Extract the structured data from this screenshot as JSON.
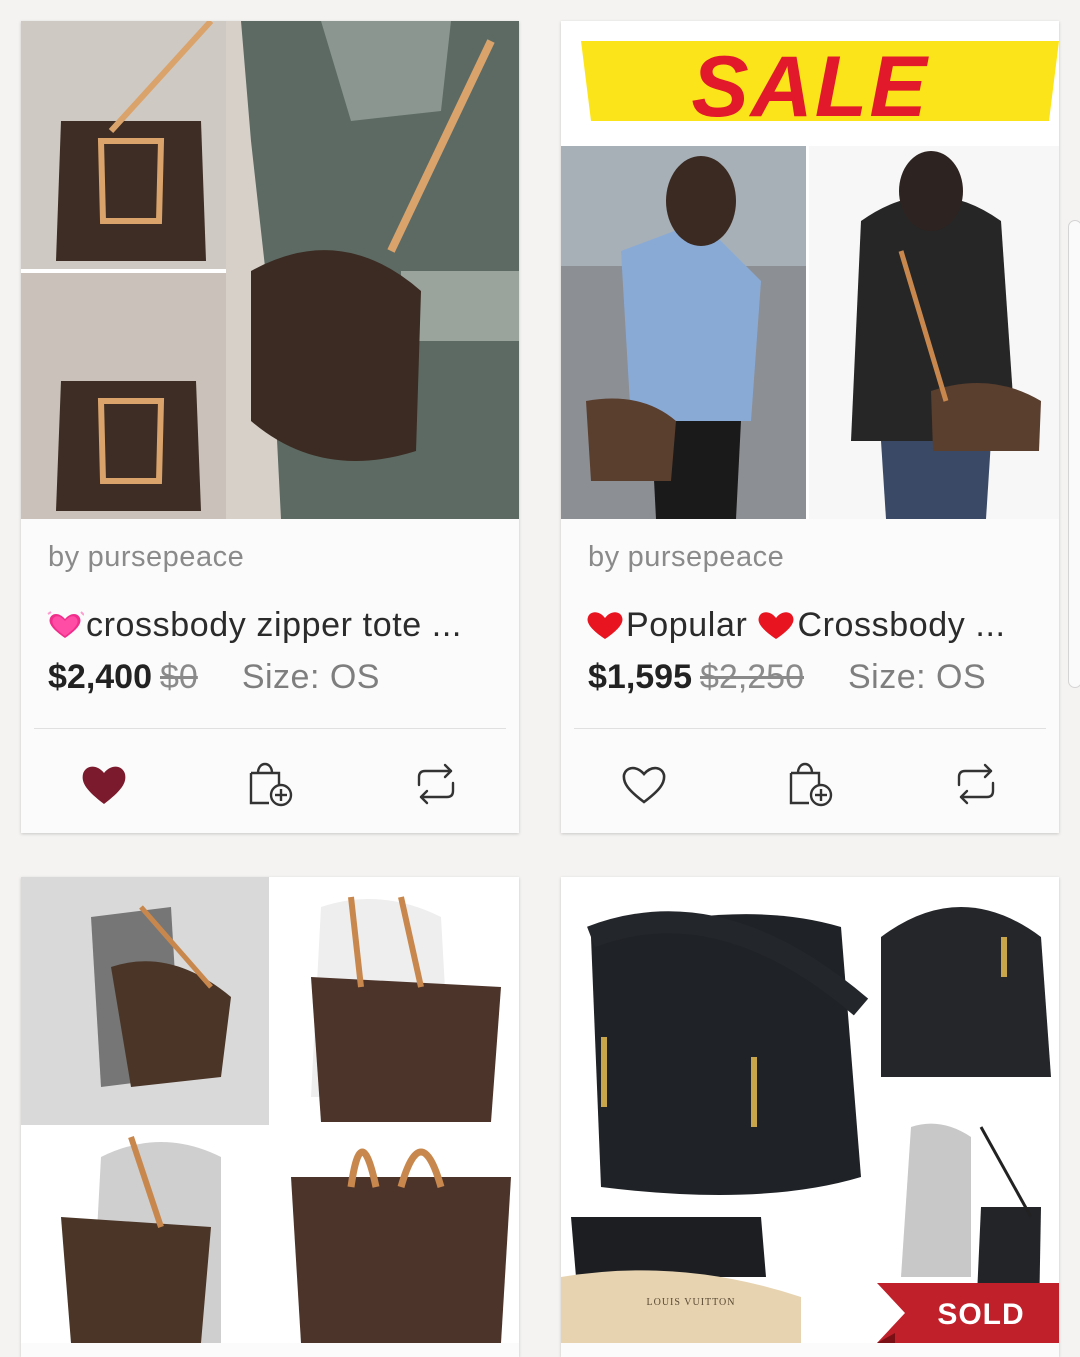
{
  "listings": [
    {
      "seller_prefix": "by",
      "seller": "pursepeace",
      "title": "crossbody zipper tote ...",
      "price": "$2,400",
      "original_price": "$0",
      "size": "Size: OS",
      "liked": true,
      "like_color": "#7b1a2c",
      "image_desc": "Monogram handbag collage"
    },
    {
      "seller_prefix": "by",
      "seller": "pursepeace",
      "title_part1": "Popular ",
      "title_part2": "Crossbody ...",
      "price": "$1,595",
      "original_price": "$2,250",
      "size": "Size: OS",
      "liked": false,
      "sale_banner": "SALE",
      "image_desc": "Sale banner with crossbody bag photos"
    },
    {
      "image_desc": "Monogram tote collage"
    },
    {
      "image_desc": "Black leather hobo bag with wallet",
      "sold_label": "SOLD",
      "dust_bag_text": "LOUIS VUITTON"
    }
  ],
  "icons": {
    "like": "heart-icon",
    "bundle": "bag-add-icon",
    "share": "share-repost-icon"
  },
  "colors": {
    "accent_like": "#7b1a2c",
    "sold_red": "#c0202a",
    "sale_yellow": "#fbe51a",
    "sale_red": "#e1192b"
  }
}
